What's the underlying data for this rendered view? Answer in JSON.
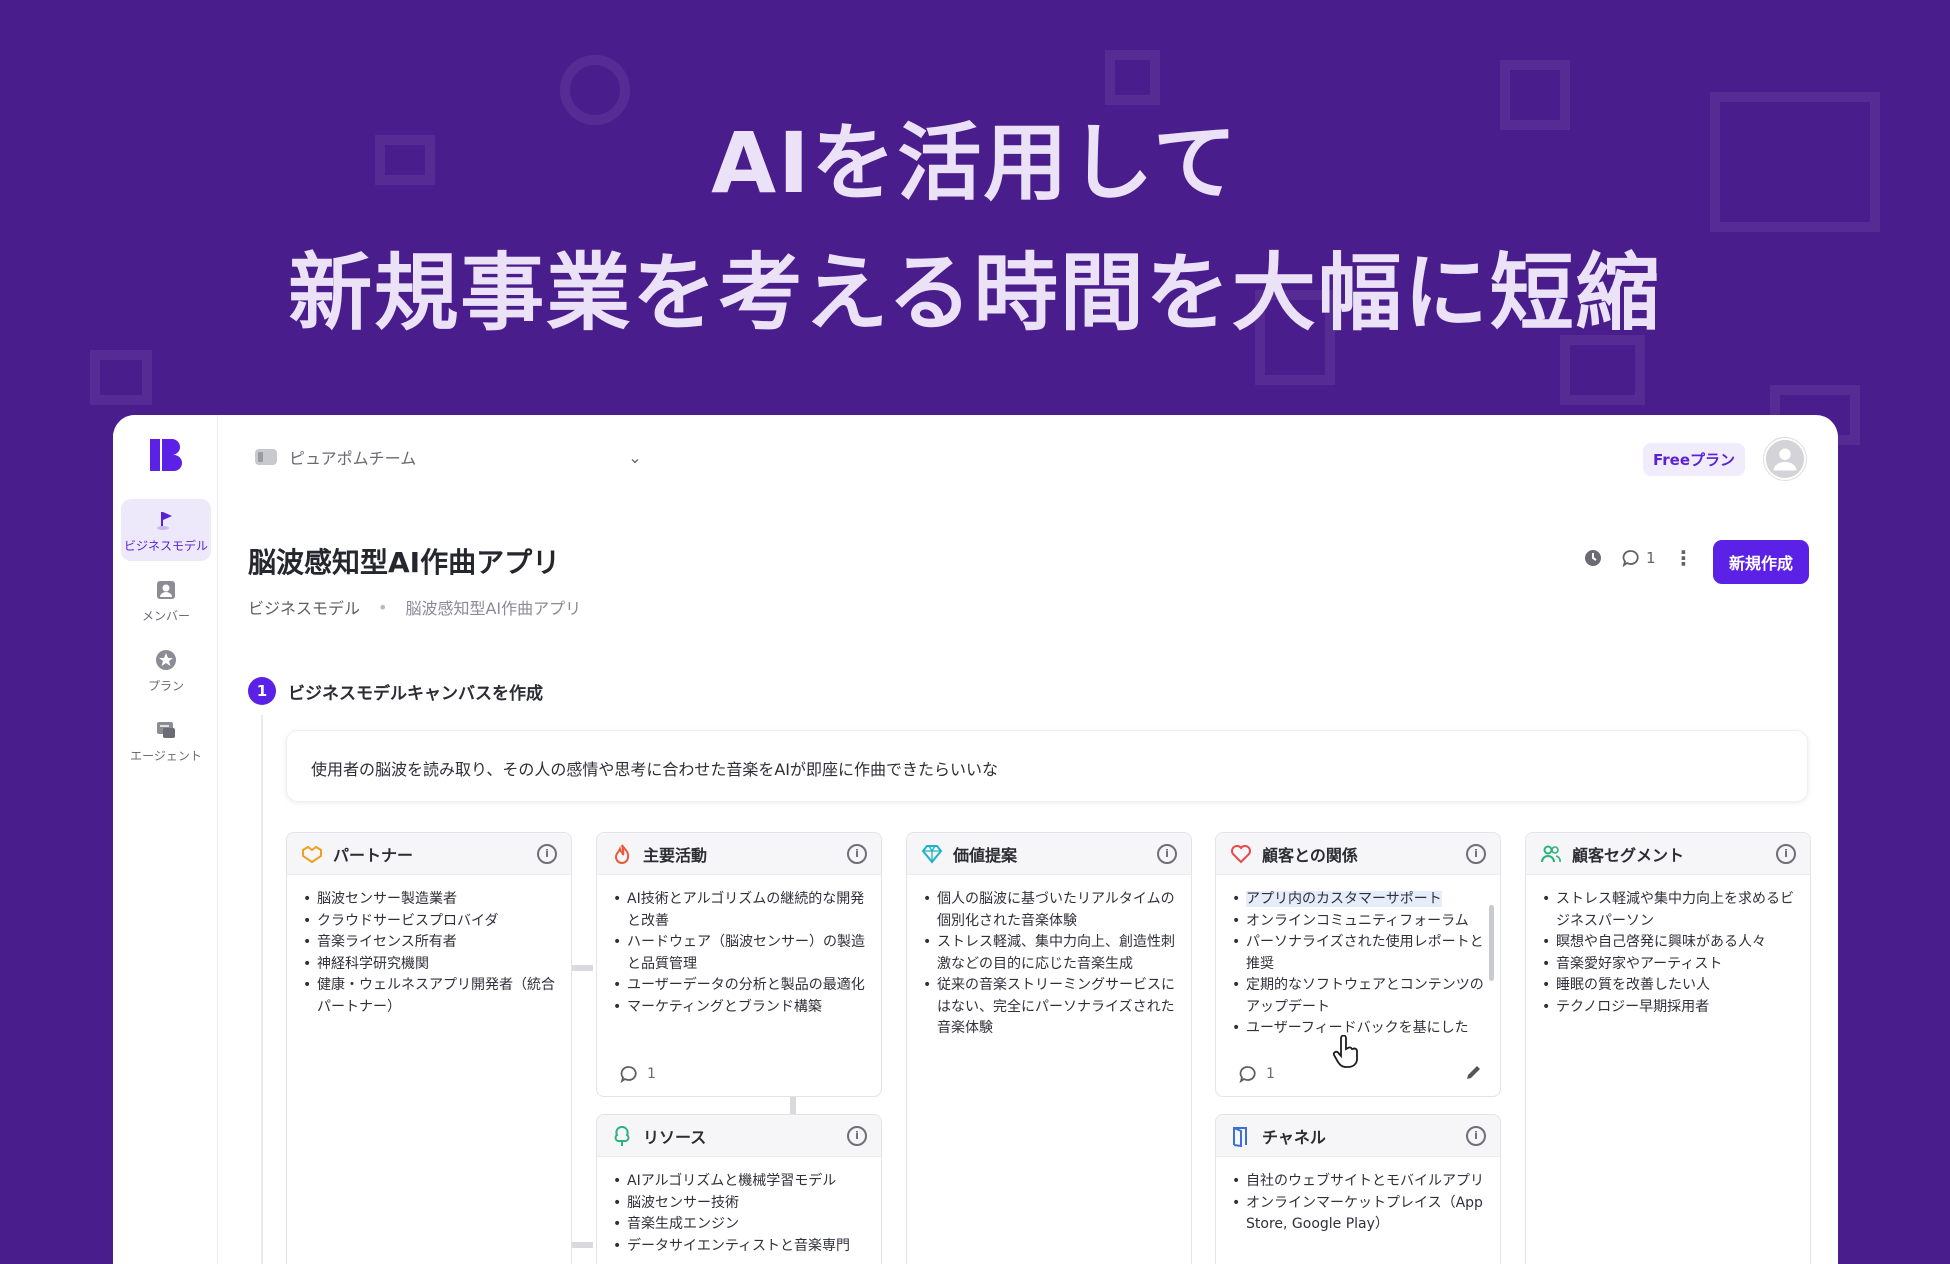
{
  "hero": {
    "line1": "AIを活用して",
    "line2": "新規事業を考える時間を大幅に短縮"
  },
  "sidebar": {
    "items": [
      {
        "label": "ビジネスモデル",
        "icon": "flag-icon"
      },
      {
        "label": "メンバー",
        "icon": "person-icon"
      },
      {
        "label": "プラン",
        "icon": "star-icon"
      },
      {
        "label": "エージェント",
        "icon": "agent-icon"
      }
    ]
  },
  "header": {
    "team": "ピュアポムチーム",
    "plan_badge": "Freeプラン"
  },
  "page": {
    "title": "脳波感知型AI作曲アプリ",
    "breadcrumb": [
      "ビジネスモデル",
      "脳波感知型AI作曲アプリ"
    ],
    "comment_count": "1",
    "new_button": "新規作成"
  },
  "step": {
    "number": "1",
    "label": "ビジネスモデルキャンバスを作成"
  },
  "prompt": "使用者の脳波を読み取り、その人の感情や思考に合わせた音楽をAIが即座に作曲できたらいいな",
  "canvas": {
    "partners": {
      "title": "パートナー",
      "items": [
        "脳波センサー製造業者",
        "クラウドサービスプロバイダ",
        "音楽ライセンス所有者",
        "神経科学研究機関",
        "健康・ウェルネスアプリ開発者（統合パートナー）"
      ]
    },
    "activities": {
      "title": "主要活動",
      "items": [
        "AI技術とアルゴリズムの継続的な開発と改善",
        "ハードウェア（脳波センサー）の製造と品質管理",
        "ユーザーデータの分析と製品の最適化",
        "マーケティングとブランド構築"
      ],
      "comments": "1"
    },
    "value": {
      "title": "価値提案",
      "items": [
        "個人の脳波に基づいたリアルタイムの個別化された音楽体験",
        "ストレス軽減、集中力向上、創造性刺激などの目的に応じた音楽生成",
        "従来の音楽ストリーミングサービスにはない、完全にパーソナライズされた音楽体験"
      ]
    },
    "relationships": {
      "title": "顧客との関係",
      "items": [
        "アプリ内のカスタマーサポート",
        "オンラインコミュニティフォーラム",
        "パーソナライズされた使用レポートと推奨",
        "定期的なソフトウェアとコンテンツのアップデート",
        "ユーザーフィードバックを基にした"
      ],
      "comments": "1"
    },
    "segments": {
      "title": "顧客セグメント",
      "items": [
        "ストレス軽減や集中力向上を求めるビジネスパーソン",
        "瞑想や自己啓発に興味がある人々",
        "音楽愛好家やアーティスト",
        "睡眠の質を改善したい人",
        "テクノロジー早期採用者"
      ]
    },
    "resources": {
      "title": "リソース",
      "items": [
        "AIアルゴリズムと機械学習モデル",
        "脳波センサー技術",
        "音楽生成エンジン",
        "データサイエンティストと音楽専門"
      ]
    },
    "channels": {
      "title": "チャネル",
      "items": [
        "自社のウェブサイトとモバイルアプリ",
        "オンラインマーケットプレイス（App Store, Google Play）"
      ]
    }
  },
  "colors": {
    "background": "#4a1d8c",
    "accent": "#5b21e6"
  }
}
